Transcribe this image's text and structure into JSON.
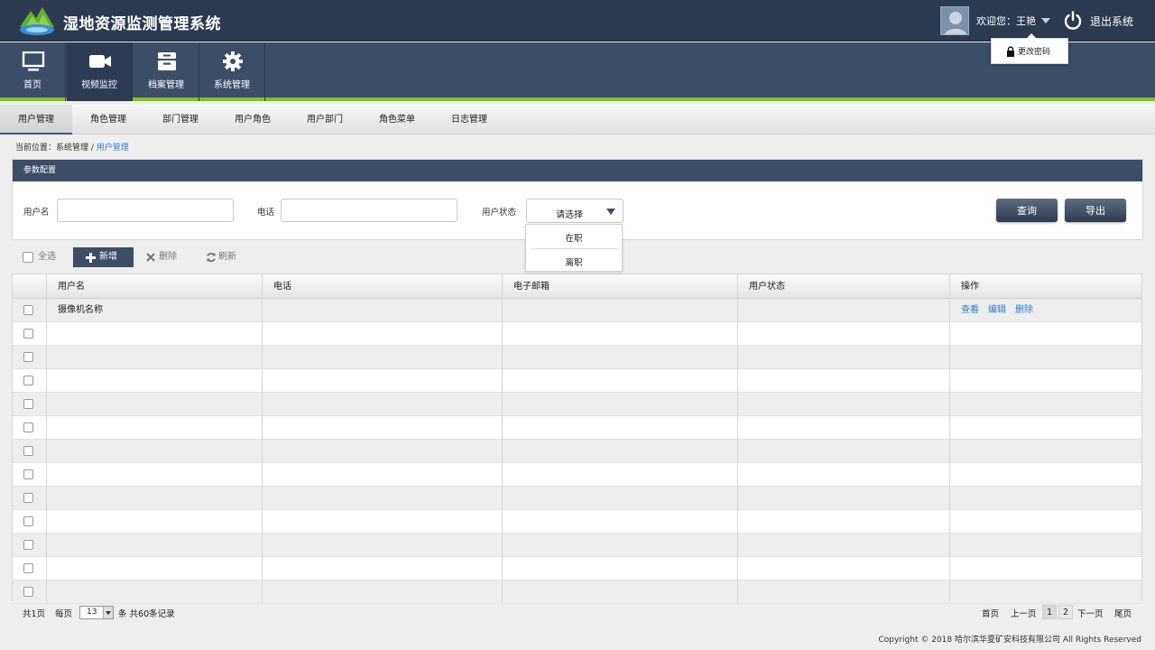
{
  "header": {
    "title": "湿地资源监测管理系统",
    "welcome": "欢迎您：王艳",
    "logout": "退出系统",
    "change_password": "更改密码"
  },
  "modules": [
    {
      "label": "首页",
      "icon": "monitor-icon"
    },
    {
      "label": "视频监控",
      "icon": "video-camera-icon"
    },
    {
      "label": "档案管理",
      "icon": "archive-box-icon"
    },
    {
      "label": "系统管理",
      "icon": "gear-icon"
    }
  ],
  "subtabs": [
    "用户管理",
    "角色管理",
    "部门管理",
    "用户角色",
    "用户部门",
    "角色菜单",
    "日志管理"
  ],
  "breadcrumb": {
    "prefix": "当前位置：系统管理 / ",
    "current": "用户管理"
  },
  "params": {
    "heading": "参数配置",
    "username_label": "用户名",
    "phone_label": "电话",
    "status_label": "用户状态",
    "status_value": "请选择",
    "status_options": [
      "在职",
      "离职"
    ],
    "query": "查询",
    "export": "导出"
  },
  "toolbar": {
    "select_all": "全选",
    "add": "新增",
    "delete": "删除",
    "refresh": "刷新"
  },
  "table": {
    "columns": [
      "用户名",
      "电话",
      "电子邮箱",
      "用户状态",
      "操作"
    ],
    "first_row": {
      "name": "摄像机名称",
      "actions": [
        "查看",
        "编辑",
        "删除"
      ]
    }
  },
  "pager": {
    "total_pages": "共1页",
    "per_page_label": "每页",
    "per_page_value": "13",
    "count": "条  共60条记录",
    "first": "首页",
    "prev": "上一页",
    "pages": [
      "1",
      "2"
    ],
    "next": "下一页",
    "last": "尾页"
  },
  "footer": "Copyright © 2018 哈尔滨华夏矿安科技有限公司 All Rights Reserved",
  "colors": {
    "header": "#2c3a50",
    "nav": "#3d4d66",
    "accent_green": "#7dc21e",
    "link": "#2f7fd0"
  }
}
